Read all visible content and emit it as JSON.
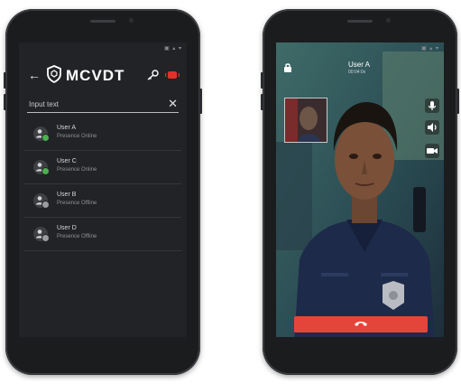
{
  "left_phone": {
    "status_icons": "▣ ▴ ▾",
    "app_title": "MCVDT",
    "search": {
      "value": "",
      "placeholder": "Input text"
    },
    "contacts": [
      {
        "name": "User A",
        "presence": "Presence Online",
        "status_color": "#4caf50"
      },
      {
        "name": "User C",
        "presence": "Presence Online",
        "status_color": "#4caf50"
      },
      {
        "name": "User B",
        "presence": "Presence Offline",
        "status_color": "#9a9ca0"
      },
      {
        "name": "User D",
        "presence": "Presence Offline",
        "status_color": "#9a9ca0"
      }
    ],
    "icons": {
      "back": "arrow-left",
      "clear": "close",
      "key": "key",
      "ptt": "push-to-talk"
    },
    "accent_color": "#e0312b"
  },
  "right_phone": {
    "status_icons": "▣ ▴ ▾",
    "caller_name": "User A",
    "call_timer": "00:04:0x",
    "controls": [
      "microphone-icon",
      "speaker-icon",
      "video-icon"
    ],
    "hangup_color": "#e4453a"
  }
}
